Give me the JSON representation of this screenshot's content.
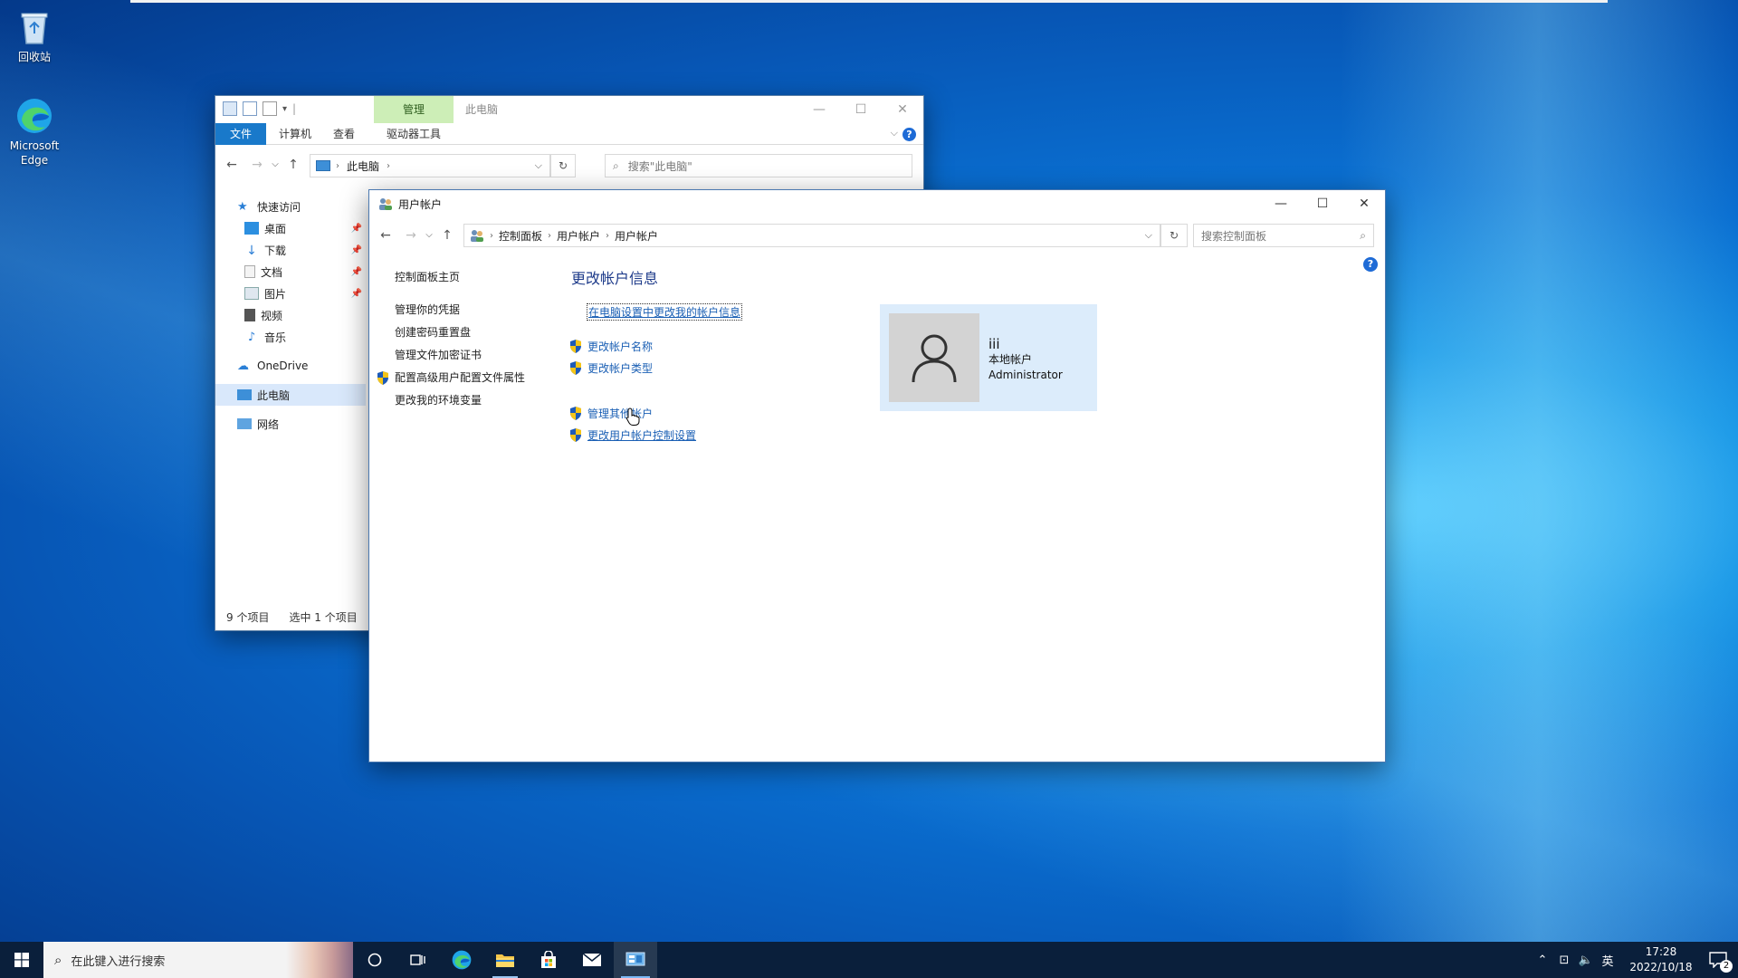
{
  "desktop": {
    "recycle_bin": "回收站",
    "edge_line1": "Microsoft",
    "edge_line2": "Edge"
  },
  "explorer": {
    "manage_tab": "管理",
    "window_title": "此电脑",
    "tabs": {
      "file": "文件",
      "computer": "计算机",
      "view": "查看",
      "drive_tools": "驱动器工具"
    },
    "address": "此电脑",
    "search_placeholder": "搜索\"此电脑\"",
    "nav": {
      "quick_access": "快速访问",
      "desktop": "桌面",
      "downloads": "下载",
      "documents": "文档",
      "pictures": "图片",
      "videos": "视频",
      "music": "音乐",
      "onedrive": "OneDrive",
      "this_pc": "此电脑",
      "network": "网络"
    },
    "status": {
      "count": "9 个项目",
      "selected": "选中 1 个项目"
    }
  },
  "user_accounts": {
    "window_title": "用户帐户",
    "breadcrumb": [
      "控制面板",
      "用户帐户",
      "用户帐户"
    ],
    "search_placeholder": "搜索控制面板",
    "left_links": {
      "home": "控制面板主页",
      "credentials": "管理你的凭据",
      "reset_disk": "创建密码重置盘",
      "encryption_certs": "管理文件加密证书",
      "advanced_profile": "配置高级用户配置文件属性",
      "env_vars": "更改我的环境变量"
    },
    "heading": "更改帐户信息",
    "links": {
      "pc_settings": "在电脑设置中更改我的帐户信息",
      "change_name": "更改帐户名称",
      "change_type": "更改帐户类型",
      "manage_other": "管理其他帐户",
      "uac_settings": "更改用户帐户控制设置"
    },
    "account": {
      "name": "iii",
      "kind": "本地帐户",
      "role": "Administrator"
    }
  },
  "taskbar": {
    "search_placeholder": "在此键入进行搜索",
    "ime": "英",
    "time": "17:28",
    "date": "2022/10/18",
    "notification_count": "2"
  }
}
